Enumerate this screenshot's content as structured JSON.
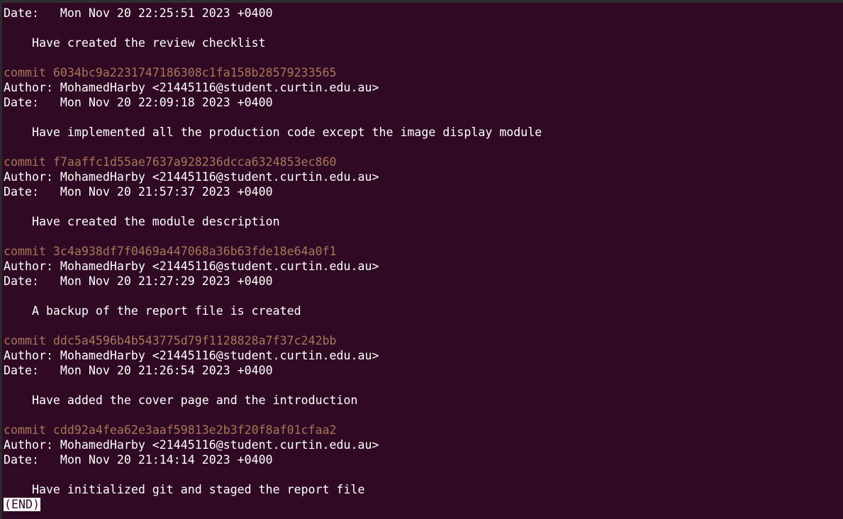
{
  "terminal": {
    "lines": [
      {
        "type": "date",
        "text": "Date:   Mon Nov 20 22:25:51 2023 +0400"
      },
      {
        "type": "blank",
        "text": ""
      },
      {
        "type": "message",
        "text": "    Have created the review checklist"
      },
      {
        "type": "blank",
        "text": ""
      },
      {
        "type": "commit",
        "text": "commit 6034bc9a2231747186308c1fa158b28579233565"
      },
      {
        "type": "author",
        "text": "Author: MohamedHarby <21445116@student.curtin.edu.au>"
      },
      {
        "type": "date",
        "text": "Date:   Mon Nov 20 22:09:18 2023 +0400"
      },
      {
        "type": "blank",
        "text": ""
      },
      {
        "type": "message",
        "text": "    Have implemented all the production code except the image display module"
      },
      {
        "type": "blank",
        "text": ""
      },
      {
        "type": "commit",
        "text": "commit f7aaffc1d55ae7637a928236dcca6324853ec860"
      },
      {
        "type": "author",
        "text": "Author: MohamedHarby <21445116@student.curtin.edu.au>"
      },
      {
        "type": "date",
        "text": "Date:   Mon Nov 20 21:57:37 2023 +0400"
      },
      {
        "type": "blank",
        "text": ""
      },
      {
        "type": "message",
        "text": "    Have created the module description"
      },
      {
        "type": "blank",
        "text": ""
      },
      {
        "type": "commit",
        "text": "commit 3c4a938df7f0469a447068a36b63fde18e64a0f1"
      },
      {
        "type": "author",
        "text": "Author: MohamedHarby <21445116@student.curtin.edu.au>"
      },
      {
        "type": "date",
        "text": "Date:   Mon Nov 20 21:27:29 2023 +0400"
      },
      {
        "type": "blank",
        "text": ""
      },
      {
        "type": "message",
        "text": "    A backup of the report file is created"
      },
      {
        "type": "blank",
        "text": ""
      },
      {
        "type": "commit",
        "text": "commit ddc5a4596b4b543775d79f1128828a7f37c242bb"
      },
      {
        "type": "author",
        "text": "Author: MohamedHarby <21445116@student.curtin.edu.au>"
      },
      {
        "type": "date",
        "text": "Date:   Mon Nov 20 21:26:54 2023 +0400"
      },
      {
        "type": "blank",
        "text": ""
      },
      {
        "type": "message",
        "text": "    Have added the cover page and the introduction"
      },
      {
        "type": "blank",
        "text": ""
      },
      {
        "type": "commit",
        "text": "commit cdd92a4fea62e3aaf59813e2b3f20f8af01cfaa2"
      },
      {
        "type": "author",
        "text": "Author: MohamedHarby <21445116@student.curtin.edu.au>"
      },
      {
        "type": "date",
        "text": "Date:   Mon Nov 20 21:14:14 2023 +0400"
      },
      {
        "type": "blank",
        "text": ""
      },
      {
        "type": "message",
        "text": "    Have initialized git and staged the report file"
      }
    ],
    "pager_status": "(END)"
  },
  "colors": {
    "background": "#300a24",
    "text": "#ffffff",
    "commit_hash": "#a8765a"
  }
}
